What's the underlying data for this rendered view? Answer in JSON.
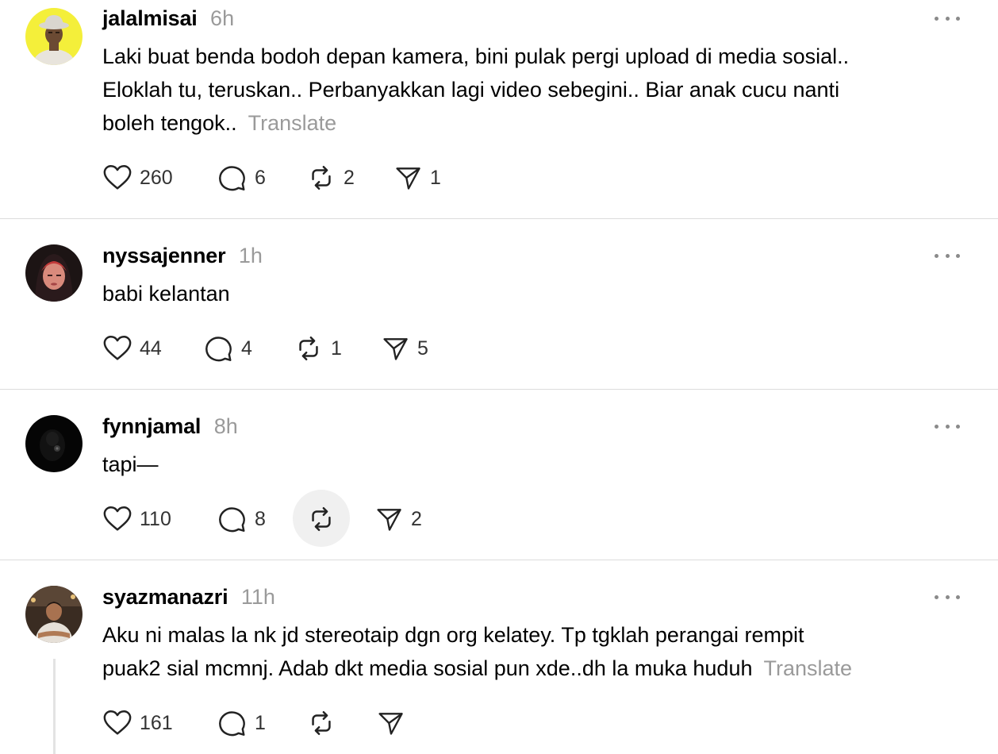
{
  "posts": [
    {
      "username": "jalalmisai",
      "time": "6h",
      "lines": [
        "Laki buat benda bodoh depan kamera, bini pulak pergi upload di media sosial..",
        "Eloklah tu, teruskan.. Perbanyakkan lagi video sebegini.. Biar anak cucu nanti",
        "boleh tengok.."
      ],
      "translate": "Translate",
      "likes": "260",
      "replies": "6",
      "reposts": "2",
      "shares": "1"
    },
    {
      "username": "nyssajenner",
      "time": "1h",
      "lines": [
        "babi kelantan"
      ],
      "likes": "44",
      "replies": "4",
      "reposts": "1",
      "shares": "5"
    },
    {
      "username": "fynnjamal",
      "time": "8h",
      "lines": [
        "tapi—"
      ],
      "likes": "110",
      "replies": "8",
      "shares": "2"
    },
    {
      "username": "syazmanazri",
      "time": "11h",
      "lines": [
        "Aku ni malas la nk jd stereotaip dgn org kelatey. Tp tgklah perangai rempit",
        "puak2 sial mcmnj. Adab dkt media sosial pun xde..dh la muka huduh"
      ],
      "translate": "Translate",
      "likes": "161",
      "replies": "1"
    }
  ],
  "icons": {
    "like": "heart-icon",
    "reply": "speech-bubble-icon",
    "repost": "repost-arrows-icon",
    "share": "paper-plane-icon",
    "more": "more-horizontal-icon"
  },
  "colors": {
    "muted_text": "#9a9a9a",
    "divider": "#dcdcdc",
    "icon_stroke": "#222222",
    "active_highlight": "#f0f0f0",
    "avatar1_bg": "#f4ef3a"
  }
}
